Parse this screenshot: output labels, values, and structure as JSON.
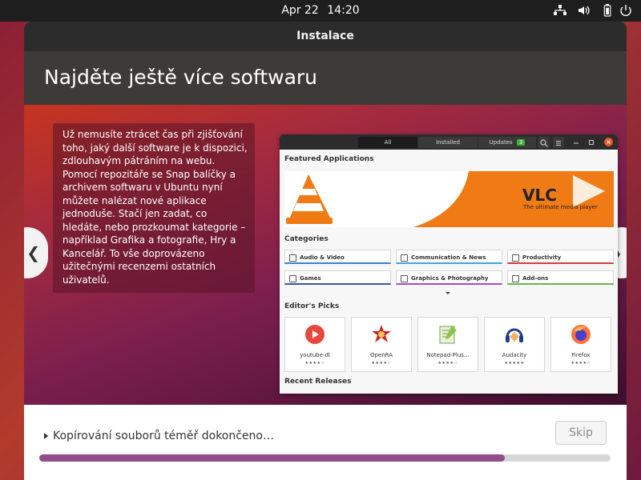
{
  "topbar": {
    "date": "Apr 22",
    "time": "14:20",
    "icons": [
      "network-icon",
      "volume-icon",
      "battery-icon",
      "power-menu-icon"
    ]
  },
  "window": {
    "title": "Instalace"
  },
  "slide": {
    "heading": "Najděte ještě více softwaru",
    "description": "Už nemusíte ztrácet čas při zjišťování toho, jaký další software je k dispozici, zdlouhavým pátráním na webu. Pomocí repozitáře se Snap balíčky a archivem softwaru v Ubuntu nyní můžete nalézat nové aplikace jednoduše. Stačí jen zadat, co hledáte, nebo prozkoumat kategorie – například Grafika a fotografie, Hry a Kancelář. To vše doprovázeno užitečnými recenzemi ostatních uživatelů.",
    "prev_symbol": "❮",
    "next_symbol": "❯"
  },
  "software_center": {
    "tabs": [
      "All",
      "Installed",
      "Updates"
    ],
    "updates_count": "3",
    "featured_title": "Featured Applications",
    "banner_name": "VLC",
    "banner_tagline": "The ultimate media player",
    "categories_title": "Categories",
    "categories": [
      {
        "label": "Audio & Video",
        "color": "#3f7fd2"
      },
      {
        "label": "Communication & News",
        "color": "#48a3d8"
      },
      {
        "label": "Productivity",
        "color": "#d53a3a"
      },
      {
        "label": "Games",
        "color": "#3c56a8"
      },
      {
        "label": "Graphics & Photography",
        "color": "#a24bc4"
      },
      {
        "label": "Add-ons",
        "color": "#6cb24a"
      }
    ],
    "picks_title": "Editor's Picks",
    "picks": [
      {
        "name": "youtube-dl",
        "stars": "★★★★☆"
      },
      {
        "name": "OpenRA",
        "stars": "★★★★☆"
      },
      {
        "name": "Notepad-Plus...",
        "stars": "★★★★☆"
      },
      {
        "name": "Audacity",
        "stars": "★★★★★"
      },
      {
        "name": "Firefox",
        "stars": "★★★★☆"
      }
    ],
    "recent_title": "Recent Releases"
  },
  "footer": {
    "status": "Kopírování souborů téměř dokončeno…",
    "skip_label": "Skip",
    "progress": 0.815
  }
}
